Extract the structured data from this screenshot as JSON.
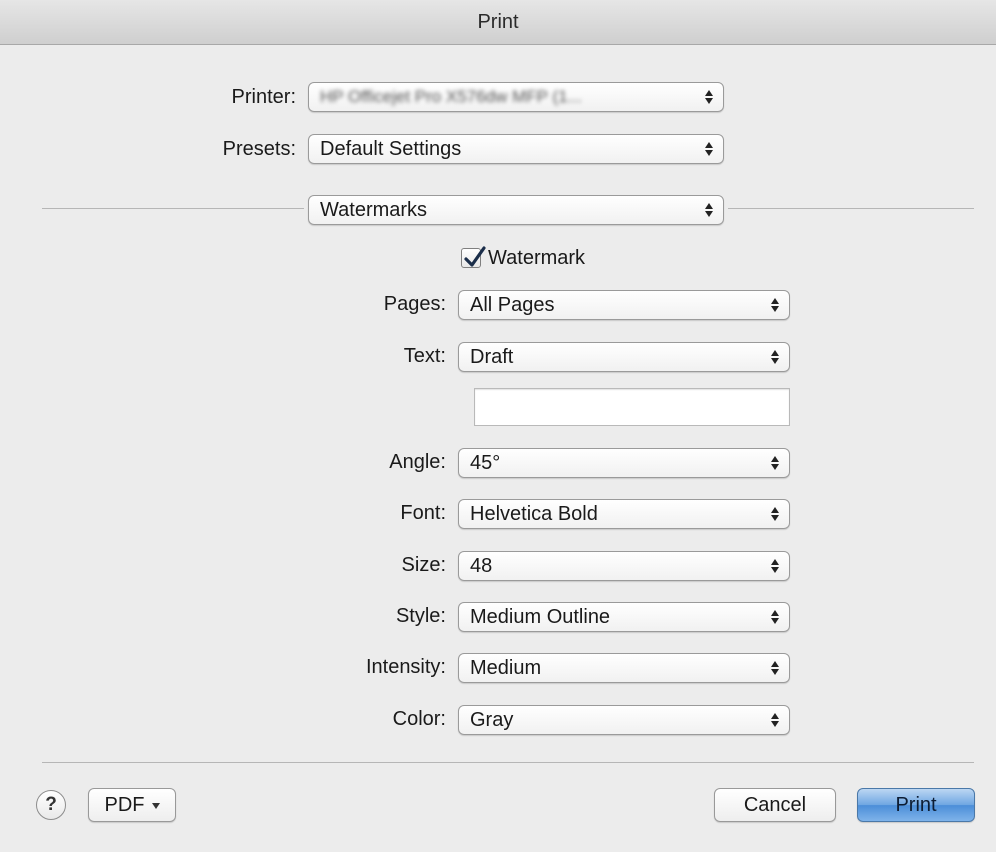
{
  "window": {
    "title": "Print"
  },
  "printer": {
    "label": "Printer:",
    "value": "HP Officejet Pro X576dw MFP (1..."
  },
  "presets": {
    "label": "Presets:",
    "value": "Default Settings"
  },
  "section": {
    "value": "Watermarks"
  },
  "watermark": {
    "label": "Watermark",
    "checked": true
  },
  "fields": [
    {
      "label": "Pages:",
      "value": "All Pages"
    },
    {
      "label": "Text:",
      "value": "Draft"
    },
    {
      "label": "Angle:",
      "value": "45°"
    },
    {
      "label": "Font:",
      "value": "Helvetica Bold"
    },
    {
      "label": "Size:",
      "value": "48"
    },
    {
      "label": "Style:",
      "value": "Medium Outline"
    },
    {
      "label": "Intensity:",
      "value": "Medium"
    },
    {
      "label": "Color:",
      "value": "Gray"
    }
  ],
  "custom_text": {
    "value": ""
  },
  "footer": {
    "help_label": "?",
    "pdf_label": "PDF",
    "cancel_label": "Cancel",
    "print_label": "Print"
  },
  "colors": {
    "accent": "#5f9ee0",
    "background": "#ececec"
  }
}
